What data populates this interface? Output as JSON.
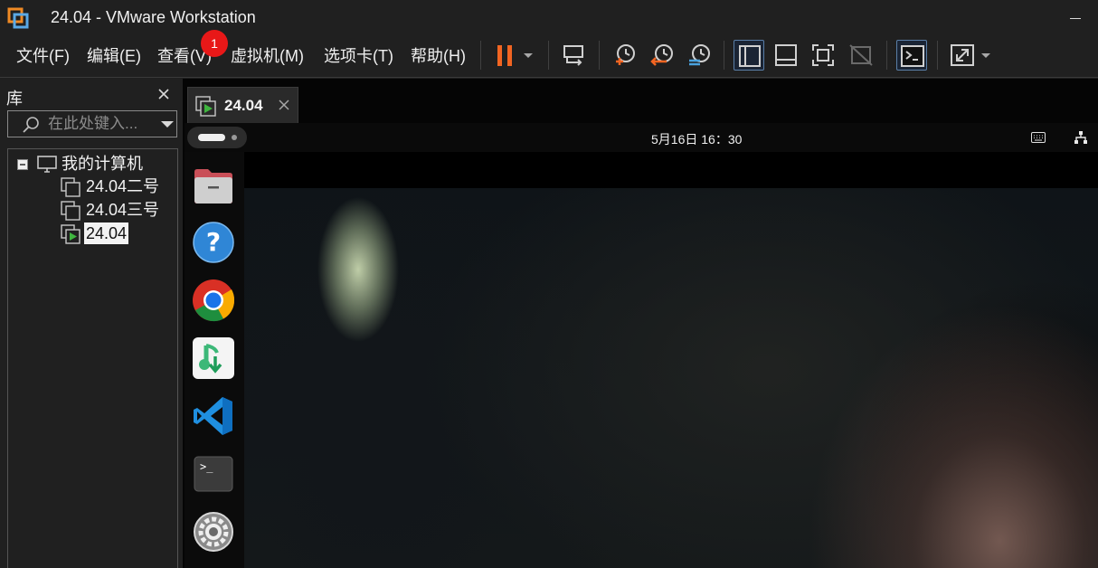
{
  "window": {
    "title": "24.04 - VMware Workstation",
    "logo_icon": "vmware-logo-icon"
  },
  "menu": {
    "items": [
      "文件(F)",
      "编辑(E)",
      "查看(V)",
      "虚拟机(M)",
      "选项卡(T)",
      "帮助(H)"
    ],
    "notification_count": "1"
  },
  "toolbar": {
    "icons": [
      "pause-icon",
      "dropdown-arrow-icon",
      "send-ctrl-alt-del-icon",
      "take-snapshot-icon",
      "revert-snapshot-icon",
      "snapshot-manager-icon",
      "show-library-icon",
      "show-thumbnail-bar-icon",
      "full-screen-icon",
      "unity-icon",
      "console-view-icon",
      "stretch-guest-icon",
      "dropdown-arrow-icon"
    ],
    "accent_color": "#f26522"
  },
  "library": {
    "title": "库",
    "search_placeholder": "在此处键入...",
    "tree": {
      "root": "我的计算机",
      "vms": [
        {
          "label": "24.04二号",
          "running": false,
          "selected": false
        },
        {
          "label": "24.04三号",
          "running": false,
          "selected": false
        },
        {
          "label": "24.04",
          "running": true,
          "selected": true
        }
      ]
    }
  },
  "tabs": [
    {
      "label": "24.04",
      "active": true
    }
  ],
  "guest": {
    "clock": "5月16日  16：30",
    "dock_apps": [
      "files-icon",
      "help-icon",
      "chrome-icon",
      "music-download-icon",
      "vscode-icon",
      "terminal-icon",
      "settings-icon"
    ]
  }
}
